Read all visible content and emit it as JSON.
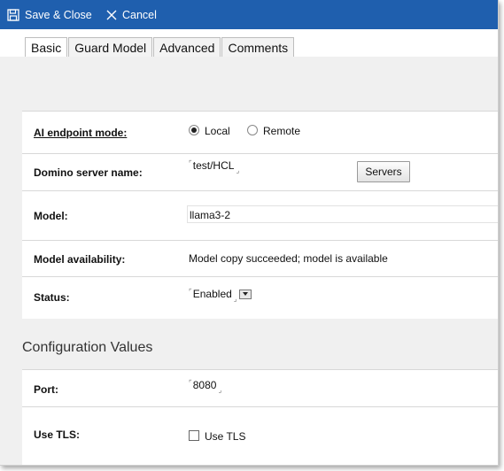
{
  "toolbar": {
    "save_label": "Save & Close",
    "cancel_label": "Cancel",
    "save_icon": "save-icon",
    "cancel_icon": "close-icon",
    "background": "#1f5fae"
  },
  "tabs": [
    {
      "label": "Basic",
      "active": true
    },
    {
      "label": "Guard Model",
      "active": false
    },
    {
      "label": "Advanced",
      "active": false
    },
    {
      "label": "Comments",
      "active": false
    }
  ],
  "form": {
    "endpoint_mode": {
      "label": "AI endpoint mode:",
      "options": [
        "Local",
        "Remote"
      ],
      "selected": "Local"
    },
    "server_name": {
      "label": "Domino server name:",
      "value": "test/HCL",
      "button_label": "Servers"
    },
    "model": {
      "label": "Model:",
      "value": "llama3-2"
    },
    "availability": {
      "label": "Model availability:",
      "value": "Model copy succeeded; model is available"
    },
    "status": {
      "label": "Status:",
      "value": "Enabled"
    }
  },
  "config": {
    "title": "Configuration Values",
    "port": {
      "label": "Port:",
      "value": "8080"
    },
    "tls": {
      "label": "Use TLS:",
      "checkbox_label": "Use TLS",
      "checked": false
    }
  }
}
